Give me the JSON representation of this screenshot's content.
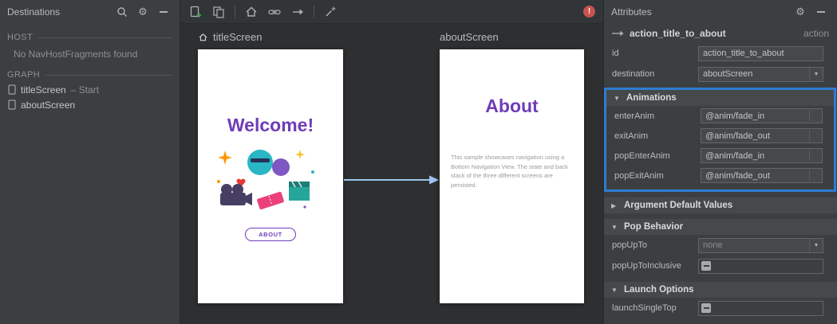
{
  "icons": {
    "gear": "⚙",
    "collapse": "▼",
    "expand": "▶",
    "dropdown_arrow": "▼",
    "error": "!"
  },
  "destinations": {
    "title": "Destinations",
    "host_section_label": "HOST",
    "host_empty_message": "No NavHostFragments found",
    "graph_section_label": "GRAPH",
    "graph_items": [
      {
        "label": "titleScreen",
        "suffix": "– Start"
      },
      {
        "label": "aboutScreen",
        "suffix": ""
      }
    ]
  },
  "canvas": {
    "screens": [
      {
        "name": "titleScreen",
        "heading": "Welcome!",
        "button_label": "ABOUT"
      },
      {
        "name": "aboutScreen",
        "heading": "About",
        "body": "This sample showcases navigation using a Bottom Navigation View. The state and back stack of the three different screens are persisted."
      }
    ]
  },
  "attributes": {
    "title": "Attributes",
    "action_name": "action_title_to_about",
    "action_type": "action",
    "id_label": "id",
    "id_value": "action_title_to_about",
    "destination_label": "destination",
    "destination_value": "aboutScreen",
    "animations": {
      "header": "Animations",
      "rows": [
        {
          "label": "enterAnim",
          "value": "@anim/fade_in"
        },
        {
          "label": "exitAnim",
          "value": "@anim/fade_out"
        },
        {
          "label": "popEnterAnim",
          "value": "@anim/fade_in"
        },
        {
          "label": "popExitAnim",
          "value": "@anim/fade_out"
        }
      ]
    },
    "argument_defaults_header": "Argument Default Values",
    "pop_behavior_header": "Pop Behavior",
    "pop_up_to_label": "popUpTo",
    "pop_up_to_value": "none",
    "pop_up_to_inclusive_label": "popUpToInclusive",
    "launch_options_header": "Launch Options",
    "launch_single_top_label": "launchSingleTop"
  },
  "colors": {
    "selection_border": "#2d7dd2",
    "heading_purple": "#6f3cb8",
    "arrow_blue": "#9cc4ec",
    "error_red": "#c75450"
  }
}
